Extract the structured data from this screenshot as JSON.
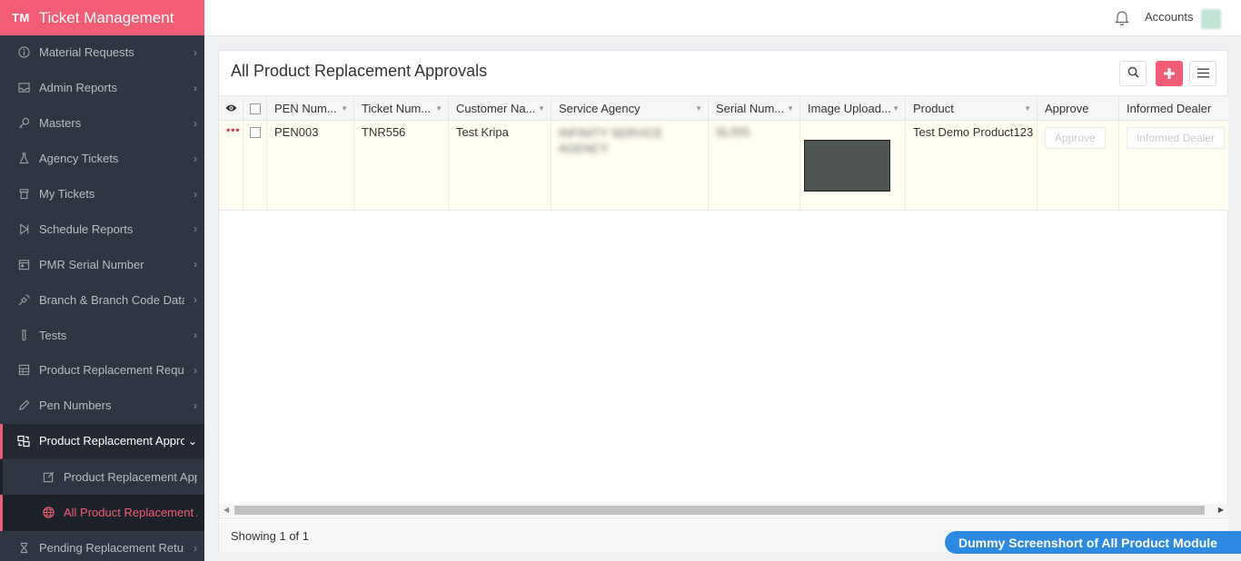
{
  "brand": {
    "logo": "TM",
    "title": "Ticket Management"
  },
  "sidebar": {
    "items": [
      {
        "label": "Material Requests",
        "icon": "info-circle-icon"
      },
      {
        "label": "Admin Reports",
        "icon": "inbox-icon"
      },
      {
        "label": "Masters",
        "icon": "key-icon"
      },
      {
        "label": "Agency Tickets",
        "icon": "flask-icon"
      },
      {
        "label": "My Tickets",
        "icon": "trash-icon"
      },
      {
        "label": "Schedule Reports",
        "icon": "play-icon"
      },
      {
        "label": "PMR Serial Number",
        "icon": "calendar-icon"
      },
      {
        "label": "Branch & Branch Code Datal",
        "icon": "satellite-icon"
      },
      {
        "label": "Tests",
        "icon": "tube-icon"
      },
      {
        "label": "Product Replacement Reque:",
        "icon": "grid-icon"
      },
      {
        "label": "Pen Numbers",
        "icon": "pen-icon"
      }
    ],
    "expanded": {
      "label": "Product Replacement Approv",
      "icon": "swap-icon"
    },
    "sub_items": [
      {
        "label": "Product Replacement Appr",
        "icon": "edit-box-icon"
      },
      {
        "label": "All Product Replacement A",
        "icon": "globe-icon"
      }
    ],
    "after": {
      "label": "Pending Replacement Return",
      "icon": "hourglass-icon"
    }
  },
  "topbar": {
    "accounts": "Accounts"
  },
  "page": {
    "title": "All Product Replacement Approvals"
  },
  "table": {
    "headers": {
      "pen": "PEN Num...",
      "ticket": "Ticket Num...",
      "customer": "Customer Na...",
      "agency": "Service Agency",
      "serial": "Serial Num...",
      "image": "Image Upload...",
      "product": "Product",
      "approve": "Approve",
      "dealer": "Informed Dealer"
    },
    "row": {
      "actions": "•••",
      "pen": "PEN003",
      "ticket": "TNR556",
      "customer": "Test Kripa",
      "agency_line1": "INFINITY SERVICE",
      "agency_line2": "AGENCY",
      "serial": "SL555",
      "product": "Test Demo Product123",
      "approve_btn": "Approve",
      "dealer_btn": "Informed Dealer"
    }
  },
  "footer": {
    "showing": "Showing 1 of 1"
  },
  "watermark": "Dummy Screenshort of All Product Module",
  "colors": {
    "accent": "#f25c74",
    "sidebar": "#2f3542",
    "watermark": "#2d8ae2"
  }
}
